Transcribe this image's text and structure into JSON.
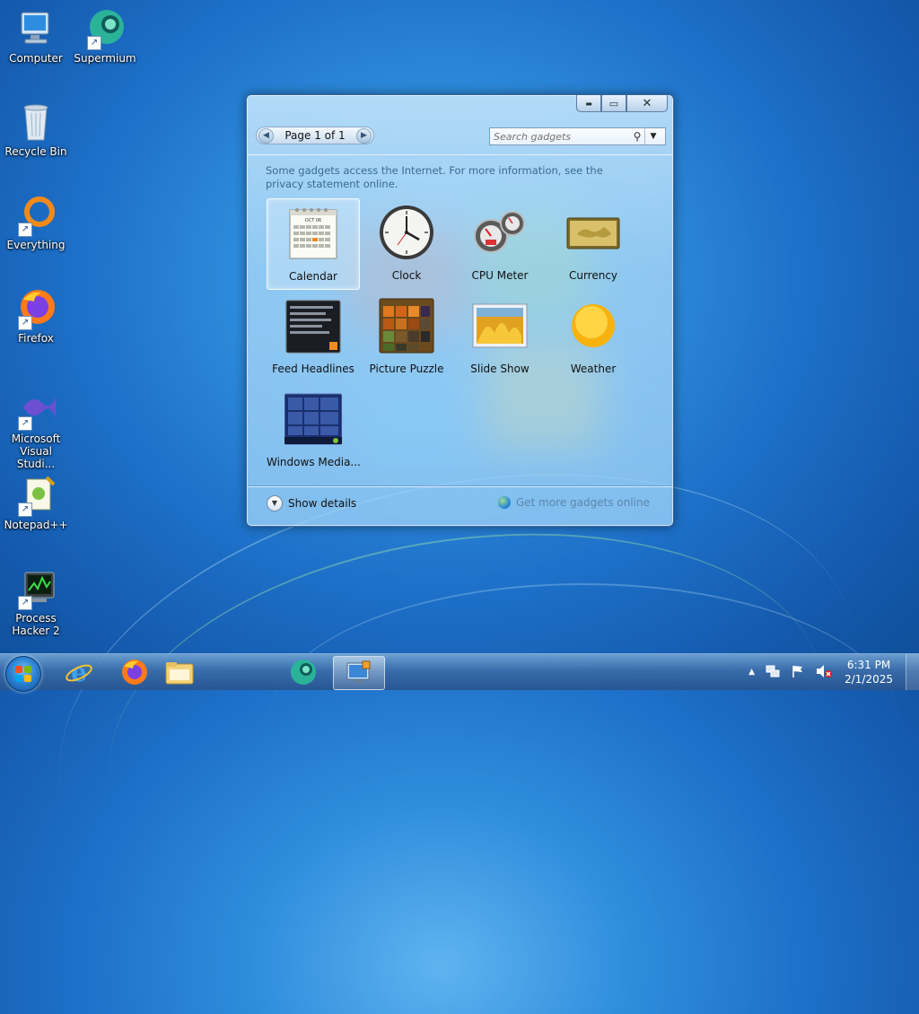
{
  "desktop": {
    "icons": [
      {
        "label": "Computer"
      },
      {
        "label": "Supermium"
      },
      {
        "label": "Recycle Bin"
      },
      {
        "label": "Everything"
      },
      {
        "label": "Firefox"
      },
      {
        "label": "Microsoft Visual Studi..."
      },
      {
        "label": "Notepad++"
      },
      {
        "label": "Process Hacker 2"
      }
    ]
  },
  "gadget_window": {
    "pager_label": "Page 1 of 1",
    "search_placeholder": "Search gadgets",
    "notice": "Some gadgets access the Internet.  For more information, see the privacy statement online.",
    "gadgets": [
      {
        "label": "Calendar",
        "selected": true
      },
      {
        "label": "Clock"
      },
      {
        "label": "CPU Meter"
      },
      {
        "label": "Currency"
      },
      {
        "label": "Feed Headlines"
      },
      {
        "label": "Picture Puzzle"
      },
      {
        "label": "Slide Show"
      },
      {
        "label": "Weather"
      },
      {
        "label": "Windows Media..."
      }
    ],
    "show_details": "Show details",
    "get_more": "Get more gadgets online",
    "calendar_month": "OCT 06",
    "minimize_glyph": "▬",
    "maximize_glyph": "▭",
    "close_glyph": "✕"
  },
  "taskbar": {
    "time": "6:31 PM",
    "date": "2/1/2025",
    "tray_arrow": "▲"
  },
  "colors": {
    "window_glass": "#a9d4f5",
    "taskbar": "#3c6eaa",
    "link": "#5a87ae"
  }
}
